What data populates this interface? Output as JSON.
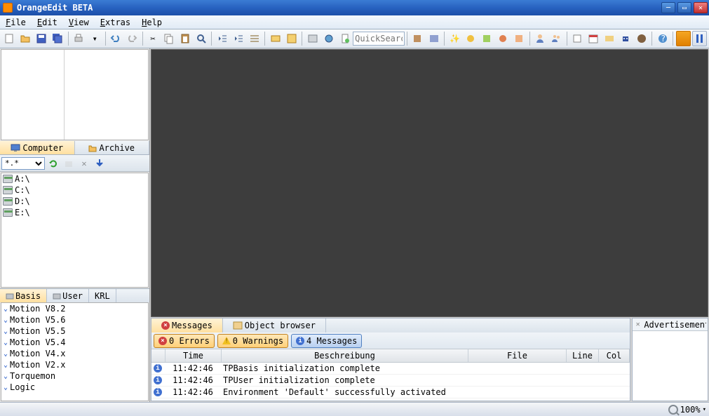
{
  "title": "OrangeEdit BETA",
  "menu": {
    "file": "File",
    "edit": "Edit",
    "view": "View",
    "extras": "Extras",
    "help": "Help"
  },
  "toolbar": {
    "quicksearch_placeholder": "QuickSearch"
  },
  "filebrowser": {
    "tabs": {
      "computer": "Computer",
      "archive": "Archive"
    },
    "filter": "*.*",
    "drives": [
      "A:\\",
      "C:\\",
      "D:\\",
      "E:\\"
    ]
  },
  "basis_panel": {
    "tabs": {
      "basis": "Basis",
      "user": "User",
      "krl": "KRL"
    },
    "items": [
      "Motion V8.2",
      "Motion V5.6",
      "Motion V5.5",
      "Motion V5.4",
      "Motion V4.x",
      "Motion V2.x",
      "Torquemon",
      "Logic"
    ]
  },
  "bottom_tabs": {
    "messages": "Messages",
    "object": "Object browser"
  },
  "filters": {
    "errors": "0 Errors",
    "warnings": "0 Warnings",
    "messages": "4 Messages"
  },
  "msg_cols": {
    "time": "Time",
    "desc": "Beschreibung",
    "file": "File",
    "line": "Line",
    "col": "Col"
  },
  "msg_rows": [
    {
      "time": "11:42:46",
      "desc": "TPBasis initialization complete"
    },
    {
      "time": "11:42:46",
      "desc": "TPUser initialization complete"
    },
    {
      "time": "11:42:46",
      "desc": "Environment 'Default' successfully activated"
    }
  ],
  "advertisement_label": "Advertisement",
  "status": {
    "zoom": "100%"
  }
}
